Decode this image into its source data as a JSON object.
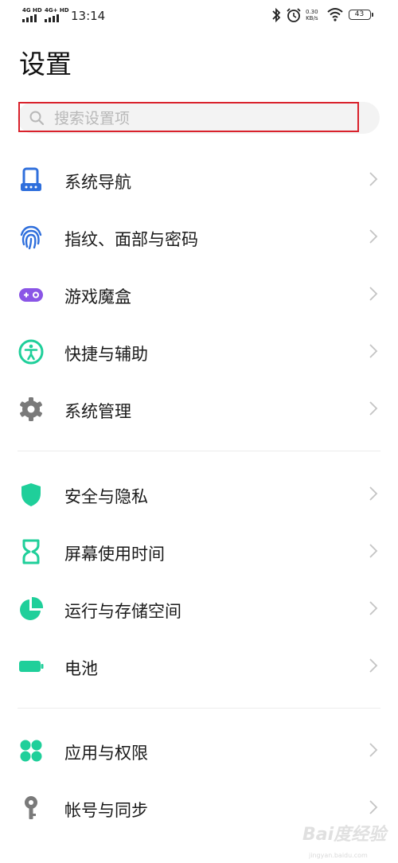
{
  "status_bar": {
    "sim1": "4G HD",
    "sim2": "4G+ HD",
    "time": "13:14",
    "net_speed": "0.30",
    "net_speed_unit": "KB/s",
    "battery": "43"
  },
  "page": {
    "title": "设置"
  },
  "search": {
    "placeholder": "搜索设置项"
  },
  "sections": [
    {
      "items": [
        {
          "label": "系统导航",
          "icon": "navigation-phone-icon",
          "color": "#2f6fdc"
        },
        {
          "label": "指纹、面部与密码",
          "icon": "fingerprint-icon",
          "color": "#2f6fdc"
        },
        {
          "label": "游戏魔盒",
          "icon": "gamepad-icon",
          "color": "#8a55e6"
        },
        {
          "label": "快捷与辅助",
          "icon": "accessibility-icon",
          "color": "#1fcf9a"
        },
        {
          "label": "系统管理",
          "icon": "gear-icon",
          "color": "#7a7a7a"
        }
      ]
    },
    {
      "items": [
        {
          "label": "安全与隐私",
          "icon": "shield-icon",
          "color": "#1fcf9a"
        },
        {
          "label": "屏幕使用时间",
          "icon": "hourglass-icon",
          "color": "#1fcf9a"
        },
        {
          "label": "运行与存储空间",
          "icon": "pie-chart-icon",
          "color": "#1fcf9a"
        },
        {
          "label": "电池",
          "icon": "battery-icon",
          "color": "#1fcf9a"
        }
      ]
    },
    {
      "items": [
        {
          "label": "应用与权限",
          "icon": "apps-icon",
          "color": "#1fcf9a"
        },
        {
          "label": "帐号与同步",
          "icon": "account-key-icon",
          "color": "#7a7a7a"
        }
      ]
    }
  ],
  "watermark": {
    "brand": "Bai度经验",
    "url": "jingyan.baidu.com"
  }
}
